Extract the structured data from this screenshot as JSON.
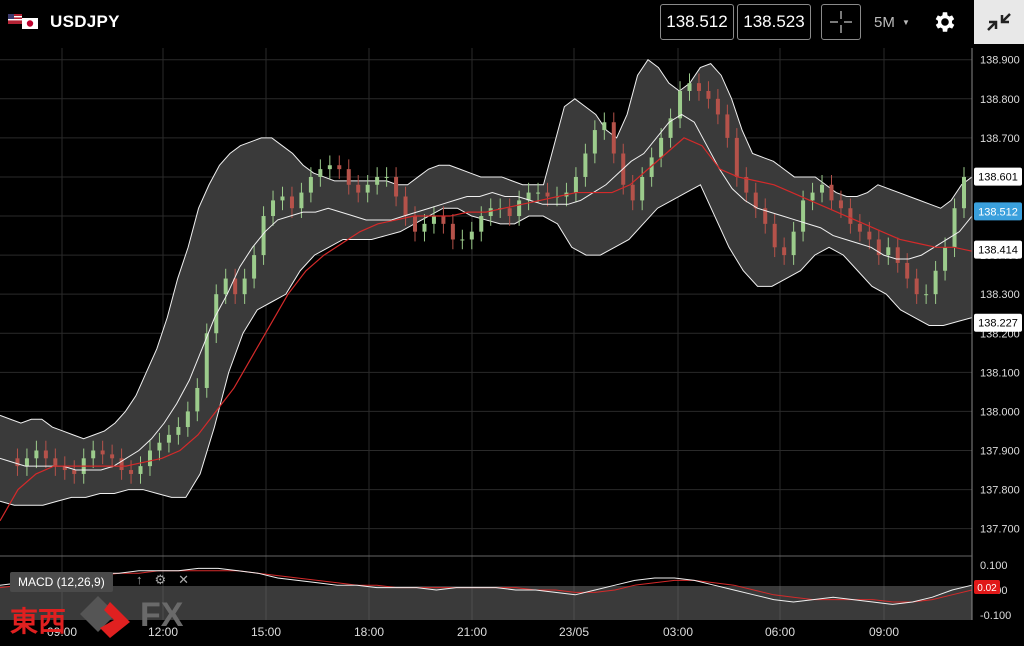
{
  "header": {
    "symbol": "USDJPY",
    "bid": "138.512",
    "ask": "138.523",
    "timeframe": "5M",
    "icons": [
      "us-jp-flag-icon",
      "crosshair-icon",
      "gear-icon",
      "collapse-icon"
    ]
  },
  "chart_data": {
    "type": "candlestick",
    "symbol": "USDJPY",
    "timeframe": "5M",
    "ylim": [
      137.63,
      138.93
    ],
    "y_ticks": [
      "138.900",
      "138.800",
      "138.700",
      "138.600",
      "138.500",
      "138.400",
      "138.300",
      "138.200",
      "138.100",
      "138.000",
      "137.900",
      "137.800",
      "137.700"
    ],
    "x_ticks": [
      "09:00",
      "12:00",
      "15:00",
      "18:00",
      "21:00",
      "23/05",
      "03:00",
      "06:00",
      "09:00"
    ],
    "price_markers": [
      {
        "value": "138.601",
        "color": "#ffffff"
      },
      {
        "value": "138.512",
        "color": "#3aa0dd"
      },
      {
        "value": "138.414",
        "color": "#ffffff"
      },
      {
        "value": "138.227",
        "color": "#ffffff"
      }
    ],
    "series": [
      {
        "name": "price",
        "values": [
          137.88,
          137.86,
          137.88,
          137.9,
          137.88,
          137.86,
          137.85,
          137.84,
          137.88,
          137.9,
          137.89,
          137.88,
          137.85,
          137.84,
          137.86,
          137.9,
          137.92,
          137.94,
          137.96,
          138.0,
          138.06,
          138.2,
          138.3,
          138.34,
          138.3,
          138.34,
          138.4,
          138.5,
          138.54,
          138.55,
          138.52,
          138.56,
          138.6,
          138.62,
          138.63,
          138.62,
          138.58,
          138.56,
          138.58,
          138.6,
          138.6,
          138.55,
          138.5,
          138.46,
          138.48,
          138.5,
          138.48,
          138.44,
          138.44,
          138.46,
          138.5,
          138.52,
          138.52,
          138.5,
          138.54,
          138.56,
          138.56,
          138.55,
          138.55,
          138.56,
          138.6,
          138.66,
          138.72,
          138.74,
          138.66,
          138.58,
          138.54,
          138.6,
          138.65,
          138.7,
          138.75,
          138.82,
          138.84,
          138.82,
          138.8,
          138.76,
          138.7,
          138.6,
          138.56,
          138.52,
          138.48,
          138.42,
          138.4,
          138.46,
          138.54,
          138.56,
          138.58,
          138.54,
          138.52,
          138.48,
          138.46,
          138.44,
          138.4,
          138.42,
          138.38,
          138.34,
          138.3,
          138.3,
          138.36,
          138.42,
          138.52,
          138.6
        ]
      },
      {
        "name": "upper",
        "values": [
          137.99,
          137.98,
          137.97,
          137.98,
          137.98,
          137.96,
          137.95,
          137.94,
          137.93,
          137.94,
          137.95,
          137.97,
          138.0,
          138.04,
          138.1,
          138.16,
          138.24,
          138.34,
          138.42,
          138.52,
          138.58,
          138.63,
          138.66,
          138.68,
          138.69,
          138.7,
          138.7,
          138.68,
          138.66,
          138.63,
          138.61,
          138.6,
          138.59,
          138.59,
          138.59,
          138.59,
          138.59,
          138.59,
          138.58,
          138.58,
          138.6,
          138.62,
          138.63,
          138.63,
          138.62,
          138.61,
          138.6,
          138.6,
          138.6,
          138.59,
          138.58,
          138.58,
          138.58,
          138.68,
          138.78,
          138.8,
          138.78,
          138.76,
          138.72,
          138.7,
          138.76,
          138.86,
          138.9,
          138.88,
          138.84,
          138.82,
          138.84,
          138.88,
          138.89,
          138.86,
          138.8,
          138.72,
          138.66,
          138.65,
          138.64,
          138.62,
          138.6,
          138.6,
          138.6,
          138.58,
          138.56,
          138.55,
          138.55,
          138.56,
          138.58,
          138.57,
          138.56,
          138.55,
          138.54,
          138.53,
          138.52,
          138.54,
          138.58,
          138.6
        ]
      },
      {
        "name": "middle",
        "values": [
          137.88,
          137.87,
          137.86,
          137.86,
          137.86,
          137.86,
          137.85,
          137.85,
          137.85,
          137.86,
          137.88,
          137.9,
          137.93,
          137.97,
          138.02,
          138.08,
          138.16,
          138.24,
          138.3,
          138.37,
          138.42,
          138.46,
          138.49,
          138.5,
          138.51,
          138.51,
          138.52,
          138.51,
          138.5,
          138.49,
          138.49,
          138.49,
          138.5,
          138.51,
          138.52,
          138.53,
          138.54,
          138.55,
          138.55,
          138.56,
          138.55,
          138.55,
          138.54,
          138.53,
          138.53,
          138.53,
          138.54,
          138.56,
          138.58,
          138.61,
          138.64,
          138.66,
          138.7,
          138.74,
          138.76,
          138.74,
          138.68,
          138.62,
          138.57,
          138.54,
          138.52,
          138.51,
          138.5,
          138.49,
          138.48,
          138.47,
          138.45,
          138.44,
          138.43,
          138.42,
          138.4,
          138.39,
          138.39,
          138.4,
          138.42,
          138.44,
          138.46,
          138.5
        ]
      },
      {
        "name": "lower",
        "values": [
          137.77,
          137.76,
          137.76,
          137.76,
          137.77,
          137.78,
          137.78,
          137.79,
          137.79,
          137.8,
          137.8,
          137.79,
          137.78,
          137.78,
          137.84,
          137.96,
          138.1,
          138.2,
          138.26,
          138.28,
          138.3,
          138.36,
          138.4,
          138.42,
          138.44,
          138.44,
          138.44,
          138.45,
          138.46,
          138.48,
          138.5,
          138.52,
          138.52,
          138.5,
          138.49,
          138.48,
          138.48,
          138.5,
          138.5,
          138.48,
          138.42,
          138.4,
          138.4,
          138.42,
          138.44,
          138.48,
          138.52,
          138.54,
          138.56,
          138.58,
          138.5,
          138.42,
          138.36,
          138.32,
          138.32,
          138.34,
          138.36,
          138.4,
          138.42,
          138.4,
          138.36,
          138.32,
          138.3,
          138.26,
          138.24,
          138.22,
          138.22,
          138.23,
          138.24
        ]
      },
      {
        "name": "ma",
        "values": [
          137.72,
          137.8,
          137.84,
          137.86,
          137.86,
          137.86,
          137.86,
          137.86,
          137.87,
          137.88,
          137.9,
          137.94,
          138.0,
          138.06,
          138.14,
          138.22,
          138.3,
          138.36,
          138.4,
          138.43,
          138.46,
          138.48,
          138.49,
          138.5,
          138.5,
          138.5,
          138.51,
          138.51,
          138.52,
          138.53,
          138.54,
          138.55,
          138.56,
          138.56,
          138.56,
          138.58,
          138.62,
          138.66,
          138.7,
          138.68,
          138.62,
          138.6,
          138.59,
          138.58,
          138.56,
          138.54,
          138.52,
          138.5,
          138.48,
          138.46,
          138.44,
          138.43,
          138.42,
          138.42,
          138.41
        ]
      }
    ],
    "macd": {
      "label": "MACD (12,26,9)",
      "y_ticks": [
        "0.100",
        "0.000",
        "-0.100"
      ],
      "last_value": "0.02",
      "macd_line": [
        0.02,
        0.03,
        0.04,
        0.05,
        0.06,
        0.07,
        0.07,
        0.08,
        0.08,
        0.08,
        0.09,
        0.09,
        0.08,
        0.07,
        0.05,
        0.04,
        0.03,
        0.02,
        0.02,
        0.01,
        0.01,
        0.01,
        0.0,
        0.01,
        0.01,
        0.01,
        0.0,
        0.0,
        -0.01,
        -0.02,
        0.0,
        0.02,
        0.04,
        0.05,
        0.05,
        0.04,
        0.02,
        0.0,
        -0.02,
        -0.04,
        -0.05,
        -0.04,
        -0.03,
        -0.04,
        -0.05,
        -0.06,
        -0.05,
        -0.03,
        0.0,
        0.02
      ],
      "signal_line": [
        0.01,
        0.02,
        0.03,
        0.04,
        0.05,
        0.06,
        0.07,
        0.07,
        0.08,
        0.08,
        0.08,
        0.08,
        0.08,
        0.07,
        0.06,
        0.05,
        0.04,
        0.03,
        0.02,
        0.02,
        0.01,
        0.01,
        0.01,
        0.01,
        0.01,
        0.01,
        0.01,
        0.0,
        0.0,
        -0.01,
        -0.01,
        0.0,
        0.02,
        0.03,
        0.04,
        0.04,
        0.03,
        0.02,
        0.0,
        -0.02,
        -0.03,
        -0.04,
        -0.04,
        -0.04,
        -0.04,
        -0.05,
        -0.05,
        -0.04,
        -0.02,
        0.0
      ]
    }
  },
  "branding": {
    "kanji": "東西",
    "fx": "FX"
  },
  "toolbar_icons": {
    "up": "↑",
    "gear": "⚙",
    "close": "✕"
  }
}
